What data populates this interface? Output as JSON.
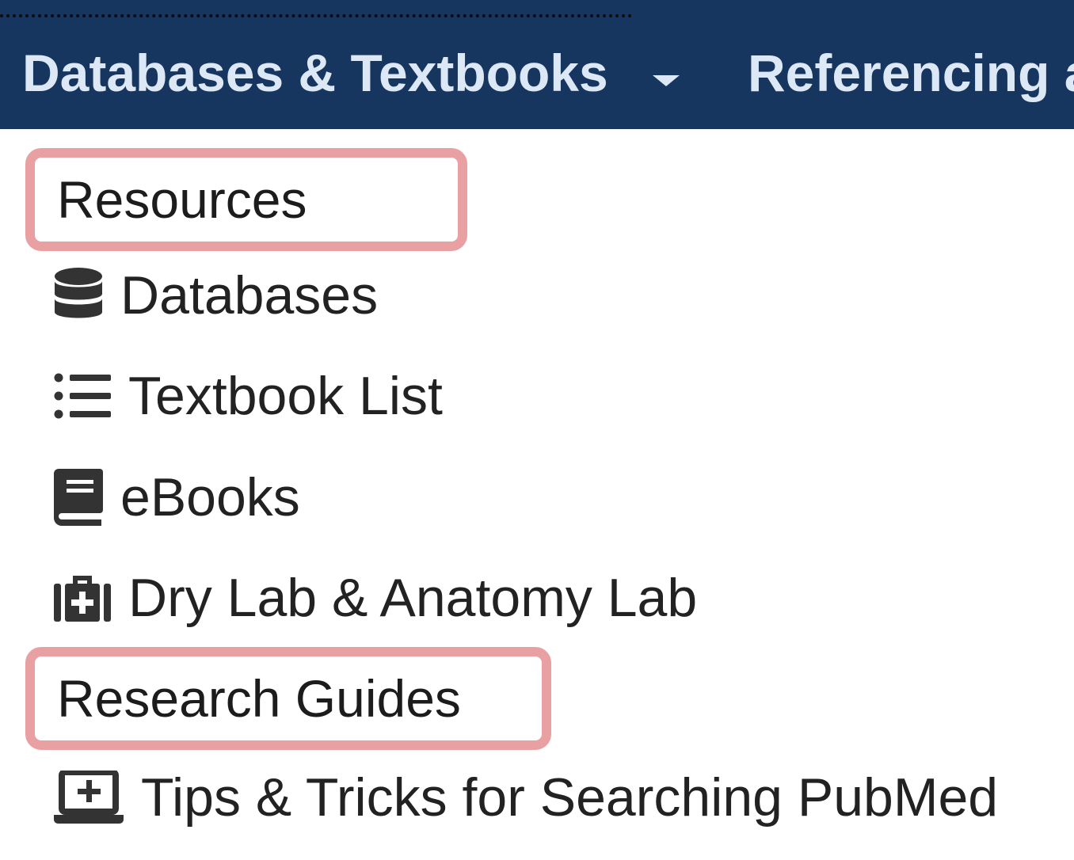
{
  "navbar": {
    "items": [
      {
        "label": "Databases & Textbooks",
        "has_dropdown": true
      },
      {
        "label": "Referencing a"
      }
    ]
  },
  "menu": {
    "sections": [
      {
        "header": "Resources",
        "links": [
          {
            "label": "Databases",
            "icon": "database-icon"
          },
          {
            "label": "Textbook List",
            "icon": "list-icon"
          },
          {
            "label": "eBooks",
            "icon": "book-icon"
          },
          {
            "label": "Dry Lab & Anatomy Lab",
            "icon": "medkit-icon"
          }
        ]
      },
      {
        "header": "Research Guides",
        "links": [
          {
            "label": "Tips & Tricks for Searching PubMed",
            "icon": "laptop-medical-icon"
          }
        ]
      }
    ]
  },
  "colors": {
    "navbar_bg": "#17365f",
    "navbar_text": "#dde8f6",
    "highlight_border": "#e8a0a2",
    "menu_text": "#222222"
  }
}
